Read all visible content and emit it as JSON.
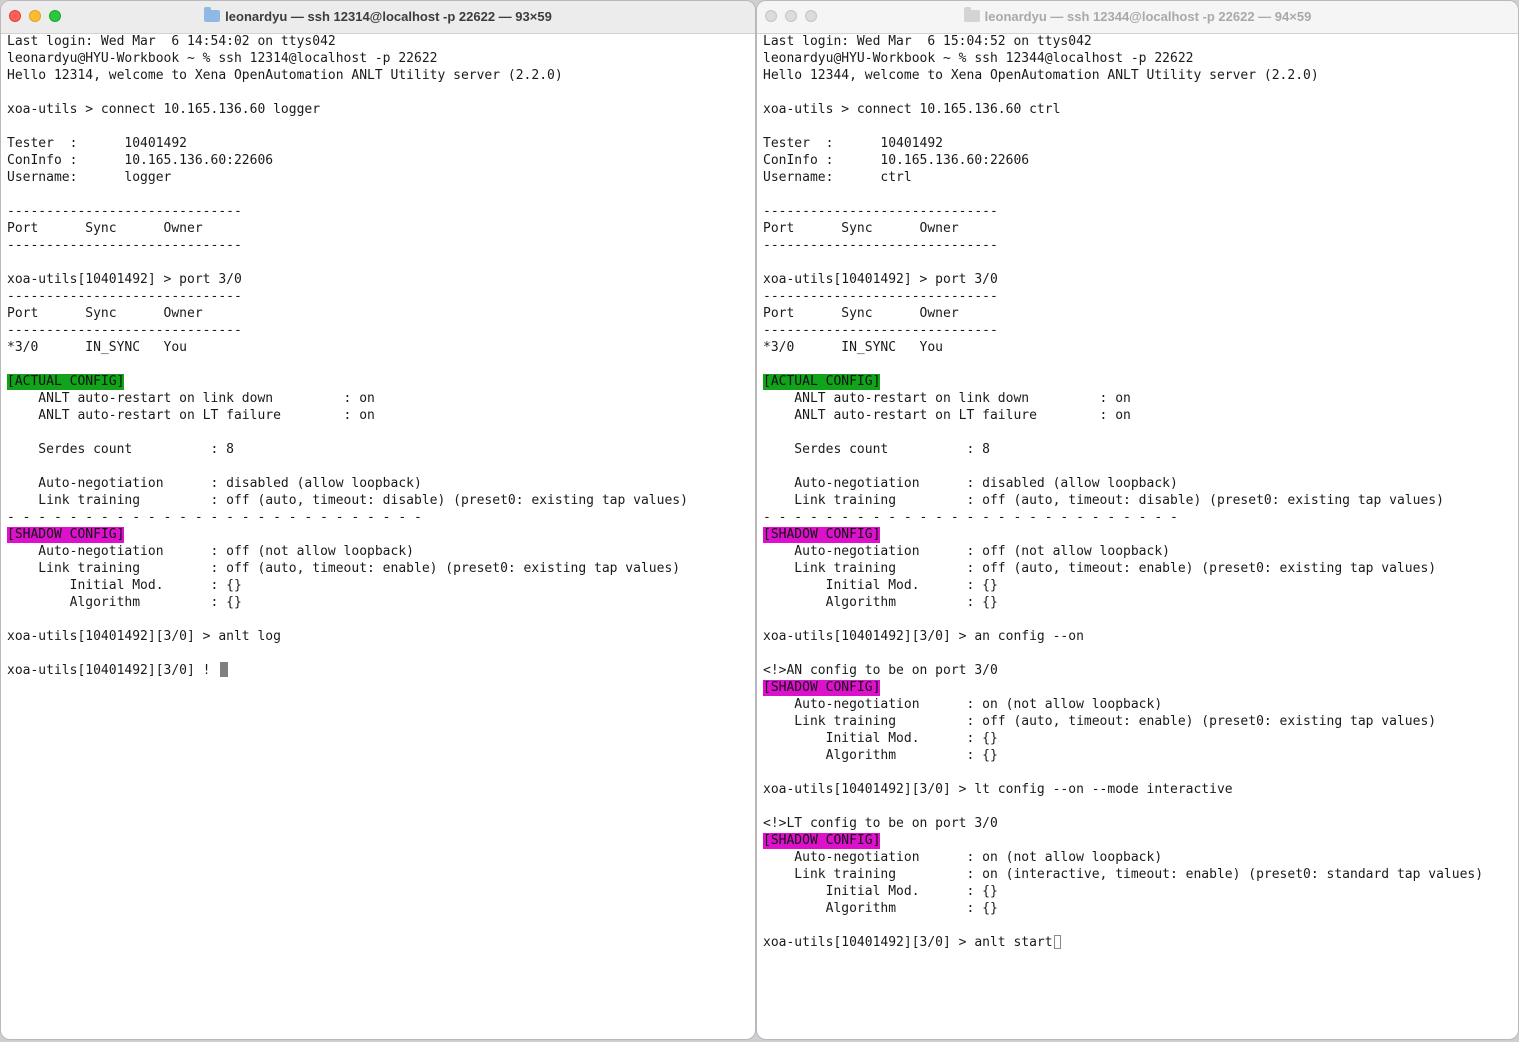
{
  "left_window": {
    "title": "leonardyu — ssh 12314@localhost -p 22622 — 93×59",
    "lines": [
      {
        "type": "text",
        "text": "Last login: Wed Mar  6 14:54:02 on ttys042"
      },
      {
        "type": "text",
        "text": "leonardyu@HYU-Workbook ~ % ssh 12314@localhost -p 22622"
      },
      {
        "type": "text",
        "text": "Hello 12314, welcome to Xena OpenAutomation ANLT Utility server (2.2.0)"
      },
      {
        "type": "text",
        "text": ""
      },
      {
        "type": "text",
        "text": "xoa-utils > connect 10.165.136.60 logger"
      },
      {
        "type": "text",
        "text": ""
      },
      {
        "type": "text",
        "text": "Tester  :      10401492"
      },
      {
        "type": "text",
        "text": "ConInfo :      10.165.136.60:22606"
      },
      {
        "type": "text",
        "text": "Username:      logger"
      },
      {
        "type": "text",
        "text": ""
      },
      {
        "type": "text",
        "text": "------------------------------"
      },
      {
        "type": "text",
        "text": "Port      Sync      Owner"
      },
      {
        "type": "text",
        "text": "------------------------------"
      },
      {
        "type": "text",
        "text": ""
      },
      {
        "type": "text",
        "text": "xoa-utils[10401492] > port 3/0"
      },
      {
        "type": "text",
        "text": "------------------------------"
      },
      {
        "type": "text",
        "text": "Port      Sync      Owner"
      },
      {
        "type": "text",
        "text": "------------------------------"
      },
      {
        "type": "text",
        "text": "*3/0      IN_SYNC   You"
      },
      {
        "type": "text",
        "text": ""
      },
      {
        "type": "tag",
        "color": "green",
        "text": "[ACTUAL CONFIG]"
      },
      {
        "type": "text",
        "text": "    ANLT auto-restart on link down         : on"
      },
      {
        "type": "text",
        "text": "    ANLT auto-restart on LT failure        : on"
      },
      {
        "type": "text",
        "text": ""
      },
      {
        "type": "text",
        "text": "    Serdes count          : 8"
      },
      {
        "type": "text",
        "text": ""
      },
      {
        "type": "text",
        "text": "    Auto-negotiation      : disabled (allow loopback)"
      },
      {
        "type": "text",
        "text": "    Link training         : off (auto, timeout: disable) (preset0: existing tap values)"
      },
      {
        "type": "text",
        "text": "- - - - - - - - - - - - - - - - - - - - - - - - - - -"
      },
      {
        "type": "tag",
        "color": "magenta",
        "text": "[SHADOW CONFIG]"
      },
      {
        "type": "text",
        "text": "    Auto-negotiation      : off (not allow loopback)"
      },
      {
        "type": "text",
        "text": "    Link training         : off (auto, timeout: enable) (preset0: existing tap values)"
      },
      {
        "type": "text",
        "text": "        Initial Mod.      : {}"
      },
      {
        "type": "text",
        "text": "        Algorithm         : {}"
      },
      {
        "type": "text",
        "text": ""
      },
      {
        "type": "text",
        "text": "xoa-utils[10401492][3/0] > anlt log"
      },
      {
        "type": "text",
        "text": ""
      },
      {
        "type": "prompt",
        "text": "xoa-utils[10401492][3/0] ! "
      }
    ]
  },
  "right_window": {
    "title": "leonardyu — ssh 12344@localhost -p 22622 — 94×59",
    "lines": [
      {
        "type": "text",
        "text": "Last login: Wed Mar  6 15:04:52 on ttys042"
      },
      {
        "type": "text",
        "text": "leonardyu@HYU-Workbook ~ % ssh 12344@localhost -p 22622"
      },
      {
        "type": "text",
        "text": "Hello 12344, welcome to Xena OpenAutomation ANLT Utility server (2.2.0)"
      },
      {
        "type": "text",
        "text": ""
      },
      {
        "type": "text",
        "text": "xoa-utils > connect 10.165.136.60 ctrl"
      },
      {
        "type": "text",
        "text": ""
      },
      {
        "type": "text",
        "text": "Tester  :      10401492"
      },
      {
        "type": "text",
        "text": "ConInfo :      10.165.136.60:22606"
      },
      {
        "type": "text",
        "text": "Username:      ctrl"
      },
      {
        "type": "text",
        "text": ""
      },
      {
        "type": "text",
        "text": "------------------------------"
      },
      {
        "type": "text",
        "text": "Port      Sync      Owner"
      },
      {
        "type": "text",
        "text": "------------------------------"
      },
      {
        "type": "text",
        "text": ""
      },
      {
        "type": "text",
        "text": "xoa-utils[10401492] > port 3/0"
      },
      {
        "type": "text",
        "text": "------------------------------"
      },
      {
        "type": "text",
        "text": "Port      Sync      Owner"
      },
      {
        "type": "text",
        "text": "------------------------------"
      },
      {
        "type": "text",
        "text": "*3/0      IN_SYNC   You"
      },
      {
        "type": "text",
        "text": ""
      },
      {
        "type": "tag",
        "color": "green",
        "text": "[ACTUAL CONFIG]"
      },
      {
        "type": "text",
        "text": "    ANLT auto-restart on link down         : on"
      },
      {
        "type": "text",
        "text": "    ANLT auto-restart on LT failure        : on"
      },
      {
        "type": "text",
        "text": ""
      },
      {
        "type": "text",
        "text": "    Serdes count          : 8"
      },
      {
        "type": "text",
        "text": ""
      },
      {
        "type": "text",
        "text": "    Auto-negotiation      : disabled (allow loopback)"
      },
      {
        "type": "text",
        "text": "    Link training         : off (auto, timeout: disable) (preset0: existing tap values)"
      },
      {
        "type": "text",
        "text": "- - - - - - - - - - - - - - - - - - - - - - - - - - -"
      },
      {
        "type": "tag",
        "color": "magenta",
        "text": "[SHADOW CONFIG]"
      },
      {
        "type": "text",
        "text": "    Auto-negotiation      : off (not allow loopback)"
      },
      {
        "type": "text",
        "text": "    Link training         : off (auto, timeout: enable) (preset0: existing tap values)"
      },
      {
        "type": "text",
        "text": "        Initial Mod.      : {}"
      },
      {
        "type": "text",
        "text": "        Algorithm         : {}"
      },
      {
        "type": "text",
        "text": ""
      },
      {
        "type": "text",
        "text": "xoa-utils[10401492][3/0] > an config --on"
      },
      {
        "type": "text",
        "text": ""
      },
      {
        "type": "text",
        "text": "<!>AN config to be on port 3/0"
      },
      {
        "type": "tag",
        "color": "magenta",
        "text": "[SHADOW CONFIG]"
      },
      {
        "type": "text",
        "text": "    Auto-negotiation      : on (not allow loopback)"
      },
      {
        "type": "text",
        "text": "    Link training         : off (auto, timeout: enable) (preset0: existing tap values)"
      },
      {
        "type": "text",
        "text": "        Initial Mod.      : {}"
      },
      {
        "type": "text",
        "text": "        Algorithm         : {}"
      },
      {
        "type": "text",
        "text": ""
      },
      {
        "type": "text",
        "text": "xoa-utils[10401492][3/0] > lt config --on --mode interactive"
      },
      {
        "type": "text",
        "text": ""
      },
      {
        "type": "text",
        "text": "<!>LT config to be on port 3/0"
      },
      {
        "type": "tag",
        "color": "magenta",
        "text": "[SHADOW CONFIG]"
      },
      {
        "type": "text",
        "text": "    Auto-negotiation      : on (not allow loopback)"
      },
      {
        "type": "text",
        "text": "    Link training         : on (interactive, timeout: enable) (preset0: standard tap values)"
      },
      {
        "type": "text",
        "text": "        Initial Mod.      : {}"
      },
      {
        "type": "text",
        "text": "        Algorithm         : {}"
      },
      {
        "type": "text",
        "text": ""
      },
      {
        "type": "prompt",
        "text": "xoa-utils[10401492][3/0] > anlt start"
      }
    ]
  },
  "colors": {
    "tag_green": "#11a31a",
    "tag_magenta": "#dd11cc",
    "close": "#ff5f57",
    "minimize": "#febc2e",
    "maximize": "#28c840"
  },
  "icons": [
    "folder-icon",
    "close-icon",
    "minimize-icon",
    "maximize-icon",
    "cursor-icon"
  ]
}
